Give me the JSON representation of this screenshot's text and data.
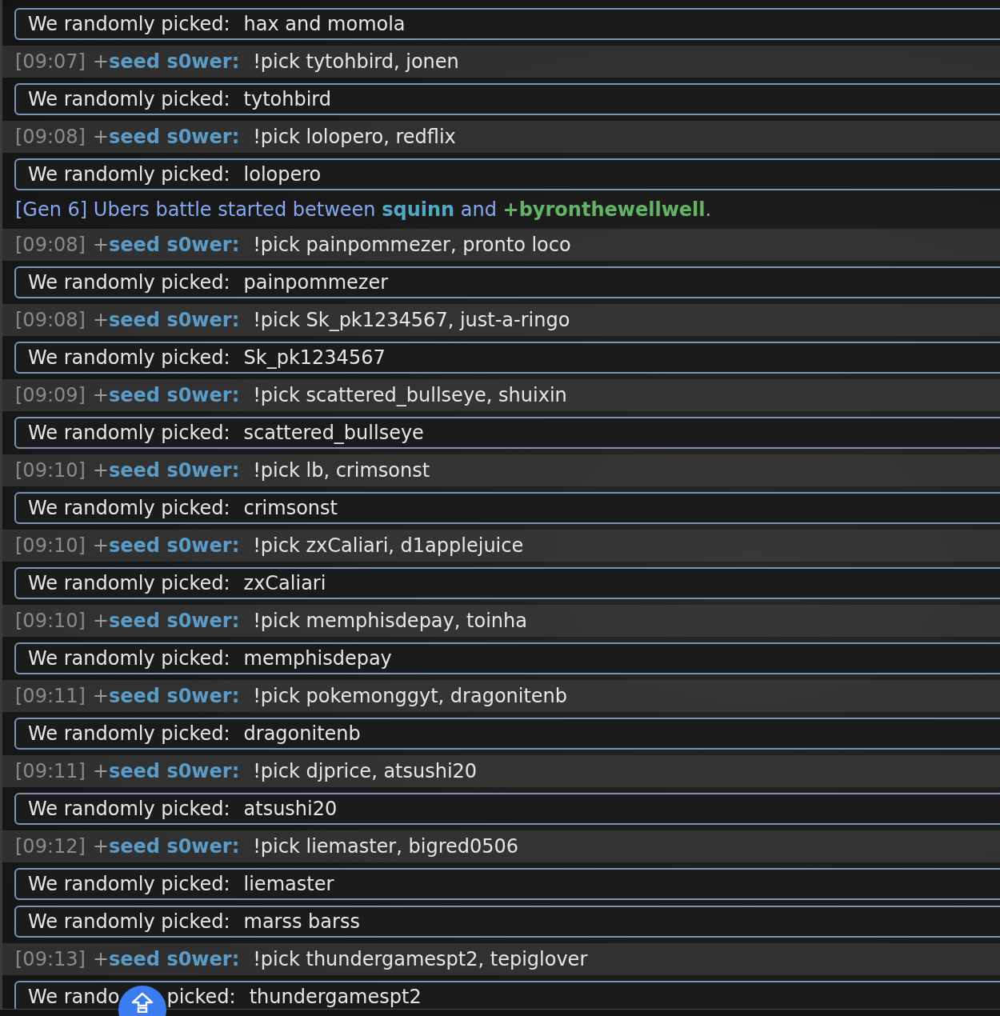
{
  "messages": [
    {
      "kind": "result",
      "label": "We randomly picked:",
      "value": "hax and momola"
    },
    {
      "kind": "chat",
      "time": "[09:07]",
      "rank": "+",
      "user": "seed s0wer:",
      "text": "!pick tytohbird, jonen"
    },
    {
      "kind": "result",
      "label": "We randomly picked:",
      "value": "tytohbird"
    },
    {
      "kind": "chat",
      "time": "[09:08]",
      "rank": "+",
      "user": "seed s0wer:",
      "text": "!pick lolopero, redflix"
    },
    {
      "kind": "result",
      "label": "We randomly picked:",
      "value": "lolopero"
    },
    {
      "kind": "battle",
      "prefix": "[Gen 6] Ubers battle started between",
      "player1": "squinn",
      "joiner": "and",
      "player2": "+byronthewellwell",
      "suffix": "."
    },
    {
      "kind": "chat",
      "time": "[09:08]",
      "rank": "+",
      "user": "seed s0wer:",
      "text": "!pick painpommezer, pronto loco"
    },
    {
      "kind": "result",
      "label": "We randomly picked:",
      "value": "painpommezer"
    },
    {
      "kind": "chat",
      "time": "[09:08]",
      "rank": "+",
      "user": "seed s0wer:",
      "text": "!pick Sk_pk1234567, just-a-ringo"
    },
    {
      "kind": "result",
      "label": "We randomly picked:",
      "value": "Sk_pk1234567"
    },
    {
      "kind": "chat",
      "time": "[09:09]",
      "rank": "+",
      "user": "seed s0wer:",
      "text": "!pick scattered_bullseye, shuixin"
    },
    {
      "kind": "result",
      "label": "We randomly picked:",
      "value": "scattered_bullseye"
    },
    {
      "kind": "chat",
      "time": "[09:10]",
      "rank": "+",
      "user": "seed s0wer:",
      "text": "!pick lb, crimsonst"
    },
    {
      "kind": "result",
      "label": "We randomly picked:",
      "value": "crimsonst"
    },
    {
      "kind": "chat",
      "time": "[09:10]",
      "rank": "+",
      "user": "seed s0wer:",
      "text": "!pick zxCaliari, d1applejuice"
    },
    {
      "kind": "result",
      "label": "We randomly picked:",
      "value": "zxCaliari"
    },
    {
      "kind": "chat",
      "time": "[09:10]",
      "rank": "+",
      "user": "seed s0wer:",
      "text": "!pick memphisdepay, toinha"
    },
    {
      "kind": "result",
      "label": "We randomly picked:",
      "value": "memphisdepay"
    },
    {
      "kind": "chat",
      "time": "[09:11]",
      "rank": "+",
      "user": "seed s0wer:",
      "text": "!pick pokemonggyt, dragonitenb"
    },
    {
      "kind": "result",
      "label": "We randomly picked:",
      "value": "dragonitenb"
    },
    {
      "kind": "chat",
      "time": "[09:11]",
      "rank": "+",
      "user": "seed s0wer:",
      "text": "!pick djprice, atsushi20"
    },
    {
      "kind": "result",
      "label": "We randomly picked:",
      "value": "atsushi20"
    },
    {
      "kind": "chat",
      "time": "[09:12]",
      "rank": "+",
      "user": "seed s0wer:",
      "text": "!pick liemaster, bigred0506"
    },
    {
      "kind": "result",
      "label": "We randomly picked:",
      "value": "liemaster"
    },
    {
      "kind": "result",
      "label": "We randomly picked:",
      "value": "marss barss"
    },
    {
      "kind": "chat",
      "time": "[09:13]",
      "rank": "+",
      "user": "seed s0wer:",
      "text": "!pick thundergamespt2, tepiglover"
    },
    {
      "kind": "result",
      "label": "We rando",
      "label_tail": "picked:",
      "value": "thundergamespt2"
    }
  ]
}
